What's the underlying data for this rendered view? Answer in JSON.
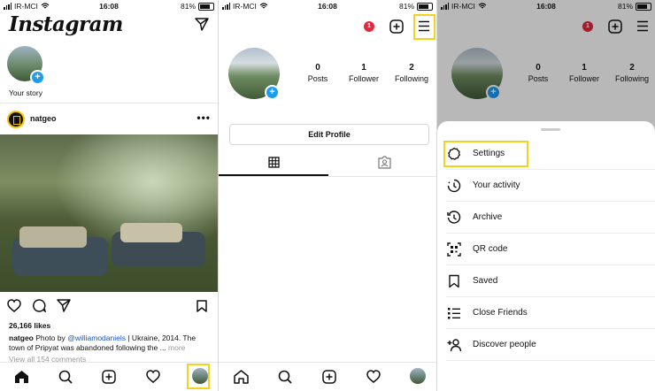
{
  "status_bar": {
    "carrier": "IR-MCI",
    "time": "16:08",
    "battery": "81%"
  },
  "feed": {
    "app_title": "Instagram",
    "story_label": "Your story",
    "post": {
      "username": "natgeo",
      "likes": "26,166 likes",
      "caption_user": "natgeo",
      "caption_prefix": "Photo by",
      "caption_mention": "@williamodaniels",
      "caption_text": "| Ukraine, 2014. The town of Pripyat was abandoned following the ...",
      "caption_more": "more",
      "view_comments": "View all 154 comments"
    }
  },
  "profile": {
    "notification_count": "1",
    "stats": [
      {
        "value": "0",
        "label": "Posts"
      },
      {
        "value": "1",
        "label": "Follower"
      },
      {
        "value": "2",
        "label": "Following"
      }
    ],
    "edit_profile_label": "Edit Profile"
  },
  "menu": {
    "items": [
      {
        "label": "Settings",
        "icon": "settings-icon"
      },
      {
        "label": "Your activity",
        "icon": "activity-icon"
      },
      {
        "label": "Archive",
        "icon": "archive-icon"
      },
      {
        "label": "QR code",
        "icon": "qr-code-icon"
      },
      {
        "label": "Saved",
        "icon": "bookmark-icon"
      },
      {
        "label": "Close Friends",
        "icon": "close-friends-icon"
      },
      {
        "label": "Discover people",
        "icon": "add-person-icon"
      }
    ]
  },
  "colors": {
    "highlight": "#f4d21f",
    "notification": "#e8263e",
    "accent_blue": "#1d9bf0",
    "mention": "#1a55c4"
  }
}
